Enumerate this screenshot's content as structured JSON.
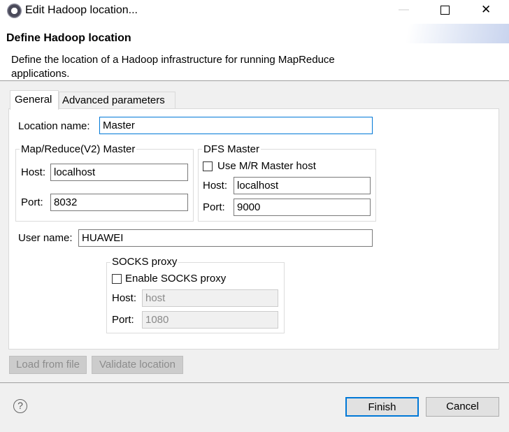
{
  "window": {
    "title": "Edit Hadoop location...",
    "minimize": "—",
    "maximize": "☐",
    "close": "✕"
  },
  "header": {
    "title": "Define Hadoop location",
    "description_line1": "Define the location of a Hadoop infrastructure for running MapReduce",
    "description_line2": "applications."
  },
  "tabs": [
    {
      "label": "General",
      "selected": true
    },
    {
      "label": "Advanced parameters",
      "selected": false
    }
  ],
  "general": {
    "location_name_label": "Location name:",
    "location_name": "Master",
    "mr_master": {
      "title": "Map/Reduce(V2) Master",
      "host_label": "Host:",
      "host": "localhost",
      "port_label": "Port:",
      "port": "8032"
    },
    "dfs_master": {
      "title": "DFS Master",
      "use_mr_label": "Use M/R Master host",
      "use_mr_checked": false,
      "host_label": "Host:",
      "host": "localhost",
      "port_label": "Port:",
      "port": "9000"
    },
    "user_name_label": "User name:",
    "user_name": "HUAWEI",
    "socks": {
      "title": "SOCKS proxy",
      "enable_label": "Enable SOCKS proxy",
      "enable_checked": false,
      "host_label": "Host:",
      "host": "host",
      "port_label": "Port:",
      "port": "1080"
    }
  },
  "actions": {
    "load": "Load from file",
    "validate": "Validate location"
  },
  "footer": {
    "help": "?",
    "finish": "Finish",
    "cancel": "Cancel"
  }
}
